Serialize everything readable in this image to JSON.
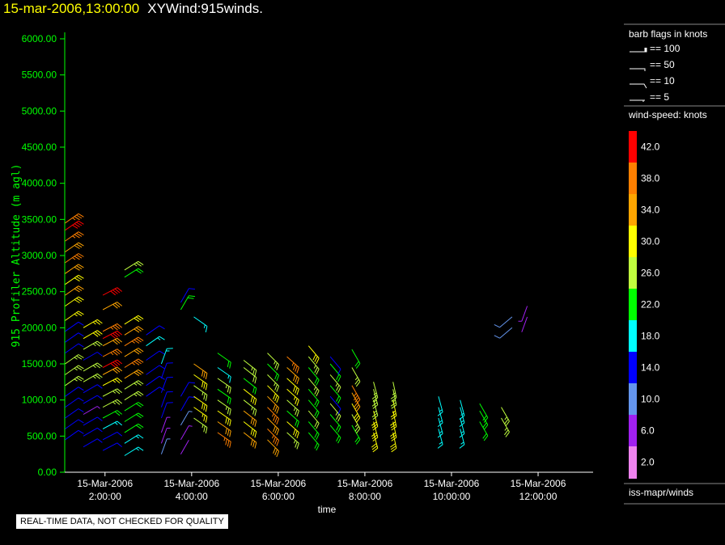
{
  "header": {
    "datetime": "15-mar-2006,13:00:00",
    "title": "XYWind:915winds."
  },
  "footer": {
    "quality_note": "REAL-TIME DATA, NOT CHECKED FOR QUALITY",
    "source": "iss-mapr/winds"
  },
  "legend": {
    "barb_title": "barb flags in knots",
    "barbs": [
      {
        "label": "== 100"
      },
      {
        "label": "== 50"
      },
      {
        "label": "== 10"
      },
      {
        "label": "== 5"
      }
    ],
    "speed_title": "wind-speed: knots",
    "bins": [
      {
        "label": "42.0",
        "color": "#ff0000"
      },
      {
        "label": "38.0",
        "color": "#ff7f00"
      },
      {
        "label": "34.0",
        "color": "#ffa500"
      },
      {
        "label": "30.0",
        "color": "#ffff00"
      },
      {
        "label": "26.0",
        "color": "#c0ff3e"
      },
      {
        "label": "22.0",
        "color": "#00ff00"
      },
      {
        "label": "18.0",
        "color": "#00ffff"
      },
      {
        "label": "14.0",
        "color": "#0000ff"
      },
      {
        "label": "10.0",
        "color": "#6495ed"
      },
      {
        "label": "6.0",
        "color": "#a020f0"
      },
      {
        "label": "2.0",
        "color": "#ee82ee"
      }
    ]
  },
  "chart_data": {
    "type": "wind-barb",
    "ylabel": "915 Profiler Altitude (m agl)",
    "xlabel": "time",
    "ylim": [
      0,
      6000
    ],
    "xlim_hours": [
      1.07,
      13.27
    ],
    "yticks": [
      "0.00",
      "500.00",
      "1000.00",
      "1500.00",
      "2000.00",
      "2500.00",
      "3000.00",
      "3500.00",
      "4000.00",
      "4500.00",
      "5000.00",
      "5500.00",
      "6000.00"
    ],
    "xticks": [
      {
        "hour": 2,
        "date": "15-Mar-2006",
        "time": "2:00:00"
      },
      {
        "hour": 4,
        "date": "15-Mar-2006",
        "time": "4:00:00"
      },
      {
        "hour": 6,
        "date": "15-Mar-2006",
        "time": "6:00:00"
      },
      {
        "hour": 8,
        "date": "15-Mar-2006",
        "time": "8:00:00"
      },
      {
        "hour": 10,
        "date": "15-Mar-2006",
        "time": "10:00:00"
      },
      {
        "hour": 12,
        "date": "15-Mar-2006",
        "time": "12:00:00"
      }
    ],
    "columns": [
      {
        "t": 1.08,
        "dir": 55,
        "levels": [
          [
            450,
            12
          ],
          [
            600,
            13
          ],
          [
            750,
            14
          ],
          [
            900,
            12
          ],
          [
            1050,
            14
          ],
          [
            1200,
            26
          ],
          [
            1350,
            27
          ],
          [
            1500,
            26
          ],
          [
            1650,
            14
          ],
          [
            1800,
            12
          ],
          [
            1950,
            14
          ],
          [
            2100,
            28
          ],
          [
            2300,
            30
          ],
          [
            2450,
            34
          ],
          [
            2600,
            30
          ],
          [
            2750,
            34
          ],
          [
            2900,
            36
          ],
          [
            3050,
            34
          ],
          [
            3200,
            38
          ],
          [
            3350,
            42
          ],
          [
            3450,
            36
          ]
        ]
      },
      {
        "t": 1.5,
        "dir": 60,
        "levels": [
          [
            350,
            13
          ],
          [
            500,
            12
          ],
          [
            650,
            14
          ],
          [
            800,
            6
          ],
          [
            950,
            14
          ],
          [
            1100,
            12
          ],
          [
            1250,
            26
          ],
          [
            1400,
            26
          ],
          [
            1550,
            13
          ],
          [
            1700,
            26
          ],
          [
            1850,
            30
          ],
          [
            2000,
            28
          ]
        ]
      },
      {
        "t": 1.95,
        "dir": 62,
        "levels": [
          [
            300,
            14
          ],
          [
            450,
            14
          ],
          [
            600,
            18
          ],
          [
            750,
            22
          ],
          [
            900,
            26
          ],
          [
            1050,
            26
          ],
          [
            1200,
            28
          ],
          [
            1350,
            34
          ],
          [
            1450,
            42
          ],
          [
            1600,
            36
          ],
          [
            1750,
            34
          ],
          [
            1850,
            42
          ],
          [
            1950,
            36
          ],
          [
            2250,
            34
          ],
          [
            2450,
            42
          ]
        ]
      },
      {
        "t": 2.45,
        "dir": 58,
        "levels": [
          [
            230,
            18
          ],
          [
            400,
            18
          ],
          [
            550,
            22
          ],
          [
            700,
            22
          ],
          [
            850,
            22
          ],
          [
            1000,
            26
          ],
          [
            1150,
            26
          ],
          [
            1300,
            34
          ],
          [
            1450,
            36
          ],
          [
            1600,
            34
          ],
          [
            1750,
            38
          ],
          [
            1900,
            34
          ],
          [
            2050,
            30
          ],
          [
            2700,
            22
          ],
          [
            2800,
            26
          ]
        ]
      },
      {
        "t": 2.95,
        "dir": 55,
        "levels": [
          [
            1050,
            14
          ],
          [
            1200,
            14
          ],
          [
            1350,
            12
          ],
          [
            1550,
            14
          ],
          [
            1750,
            18
          ],
          [
            1900,
            12
          ]
        ]
      },
      {
        "t": 3.3,
        "dir": 20,
        "levels": [
          [
            250,
            8
          ],
          [
            400,
            6
          ],
          [
            550,
            7
          ],
          [
            750,
            12
          ],
          [
            900,
            14
          ],
          [
            1100,
            13
          ],
          [
            1300,
            14
          ],
          [
            1500,
            16
          ]
        ]
      },
      {
        "t": 3.75,
        "dir": 30,
        "levels": [
          [
            250,
            4
          ],
          [
            450,
            6
          ],
          [
            650,
            8
          ],
          [
            850,
            13
          ],
          [
            1050,
            14
          ],
          [
            2250,
            22
          ],
          [
            2350,
            14
          ]
        ]
      },
      {
        "t": 4.05,
        "dir": 125,
        "levels": [
          [
            750,
            26
          ],
          [
            900,
            28
          ],
          [
            1050,
            30
          ],
          [
            1200,
            26
          ],
          [
            1350,
            30
          ],
          [
            1500,
            33
          ],
          [
            2150,
            18
          ]
        ]
      },
      {
        "t": 4.6,
        "dir": 125,
        "levels": [
          [
            550,
            36
          ],
          [
            700,
            34
          ],
          [
            850,
            30
          ],
          [
            1000,
            26
          ],
          [
            1150,
            22
          ],
          [
            1300,
            26
          ],
          [
            1450,
            18
          ],
          [
            1650,
            22
          ]
        ]
      },
      {
        "t": 5.2,
        "dir": 128,
        "levels": [
          [
            550,
            34
          ],
          [
            700,
            30
          ],
          [
            850,
            34
          ],
          [
            1000,
            26
          ],
          [
            1150,
            30
          ],
          [
            1300,
            22
          ],
          [
            1450,
            24
          ],
          [
            1550,
            26
          ]
        ]
      },
      {
        "t": 5.75,
        "dir": 135,
        "levels": [
          [
            450,
            34
          ],
          [
            600,
            36
          ],
          [
            750,
            34
          ],
          [
            900,
            36
          ],
          [
            1050,
            34
          ],
          [
            1200,
            30
          ],
          [
            1350,
            26
          ],
          [
            1500,
            22
          ],
          [
            1650,
            26
          ]
        ]
      },
      {
        "t": 6.2,
        "dir": 132,
        "levels": [
          [
            550,
            26
          ],
          [
            700,
            30
          ],
          [
            850,
            22
          ],
          [
            1000,
            26
          ],
          [
            1150,
            28
          ],
          [
            1300,
            30
          ],
          [
            1450,
            34
          ],
          [
            1600,
            36
          ]
        ]
      },
      {
        "t": 6.7,
        "dir": 140,
        "levels": [
          [
            550,
            22
          ],
          [
            700,
            22
          ],
          [
            850,
            24
          ],
          [
            1000,
            22
          ],
          [
            1150,
            22
          ],
          [
            1300,
            26
          ],
          [
            1450,
            22
          ],
          [
            1600,
            26
          ],
          [
            1750,
            30
          ]
        ]
      },
      {
        "t": 7.2,
        "dir": 140,
        "levels": [
          [
            650,
            22
          ],
          [
            800,
            22
          ],
          [
            950,
            26
          ],
          [
            1050,
            14
          ],
          [
            1200,
            22
          ],
          [
            1350,
            26
          ],
          [
            1500,
            22
          ],
          [
            1600,
            14
          ]
        ]
      },
      {
        "t": 7.7,
        "dir": 150,
        "levels": [
          [
            650,
            22
          ],
          [
            800,
            26
          ],
          [
            950,
            30
          ],
          [
            1100,
            34
          ],
          [
            1200,
            38
          ],
          [
            1450,
            26
          ],
          [
            1700,
            22
          ]
        ]
      },
      {
        "t": 8.2,
        "dir": 165,
        "levels": [
          [
            550,
            30
          ],
          [
            700,
            30
          ],
          [
            850,
            30
          ],
          [
            1000,
            26
          ],
          [
            1150,
            26
          ],
          [
            1250,
            26
          ]
        ]
      },
      {
        "t": 8.65,
        "dir": 168,
        "levels": [
          [
            550,
            30
          ],
          [
            700,
            30
          ],
          [
            850,
            30
          ],
          [
            1000,
            28
          ],
          [
            1150,
            26
          ],
          [
            1250,
            26
          ]
        ]
      },
      {
        "t": 9.7,
        "dir": 165,
        "levels": [
          [
            600,
            18
          ],
          [
            750,
            18
          ],
          [
            900,
            18
          ],
          [
            1050,
            18
          ]
        ]
      },
      {
        "t": 10.2,
        "dir": 165,
        "levels": [
          [
            600,
            18
          ],
          [
            750,
            18
          ],
          [
            900,
            18
          ],
          [
            1000,
            18
          ]
        ]
      },
      {
        "t": 10.65,
        "dir": 150,
        "levels": [
          [
            700,
            22
          ],
          [
            850,
            22
          ],
          [
            950,
            22
          ]
        ]
      },
      {
        "t": 11.15,
        "dir": 150,
        "levels": [
          [
            750,
            26
          ],
          [
            900,
            26
          ]
        ]
      },
      {
        "t": 11.4,
        "dir": 230,
        "levels": [
          [
            2000,
            10
          ],
          [
            2150,
            10
          ]
        ]
      },
      {
        "t": 11.75,
        "dir": 200,
        "levels": [
          [
            2150,
            4
          ],
          [
            2300,
            6
          ]
        ]
      }
    ]
  }
}
